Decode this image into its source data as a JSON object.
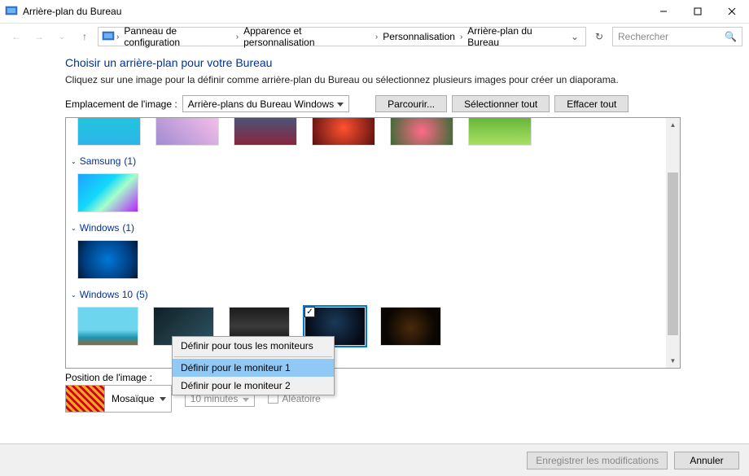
{
  "window": {
    "title": "Arrière-plan du Bureau"
  },
  "breadcrumb": {
    "items": [
      "Panneau de configuration",
      "Apparence et personnalisation",
      "Personnalisation",
      "Arrière-plan du Bureau"
    ]
  },
  "search": {
    "placeholder": "Rechercher"
  },
  "page": {
    "title": "Choisir un arrière-plan pour votre Bureau",
    "description": "Cliquez sur une image pour la définir comme arrière-plan du Bureau ou sélectionnez plusieurs images pour créer un diaporama."
  },
  "location": {
    "label": "Emplacement de l'image :",
    "value": "Arrière-plans du Bureau Windows"
  },
  "buttons": {
    "browse": "Parcourir...",
    "select_all": "Sélectionner tout",
    "clear_all": "Effacer tout"
  },
  "groups": {
    "samsung": {
      "label": "Samsung",
      "count": "(1)"
    },
    "windows": {
      "label": "Windows",
      "count": "(1)"
    },
    "windows10": {
      "label": "Windows 10",
      "count": "(5)"
    }
  },
  "context_menu": {
    "item_all": "Définir pour tous les moniteurs",
    "item_mon1": "Définir pour le moniteur 1",
    "item_mon2": "Définir pour le moniteur 2"
  },
  "position": {
    "label": "Position de l'image :",
    "value": "Mosaïque"
  },
  "interval": {
    "value": "10 minutes"
  },
  "random": {
    "label": "Aléatoire"
  },
  "footer": {
    "save": "Enregistrer les modifications",
    "cancel": "Annuler"
  }
}
